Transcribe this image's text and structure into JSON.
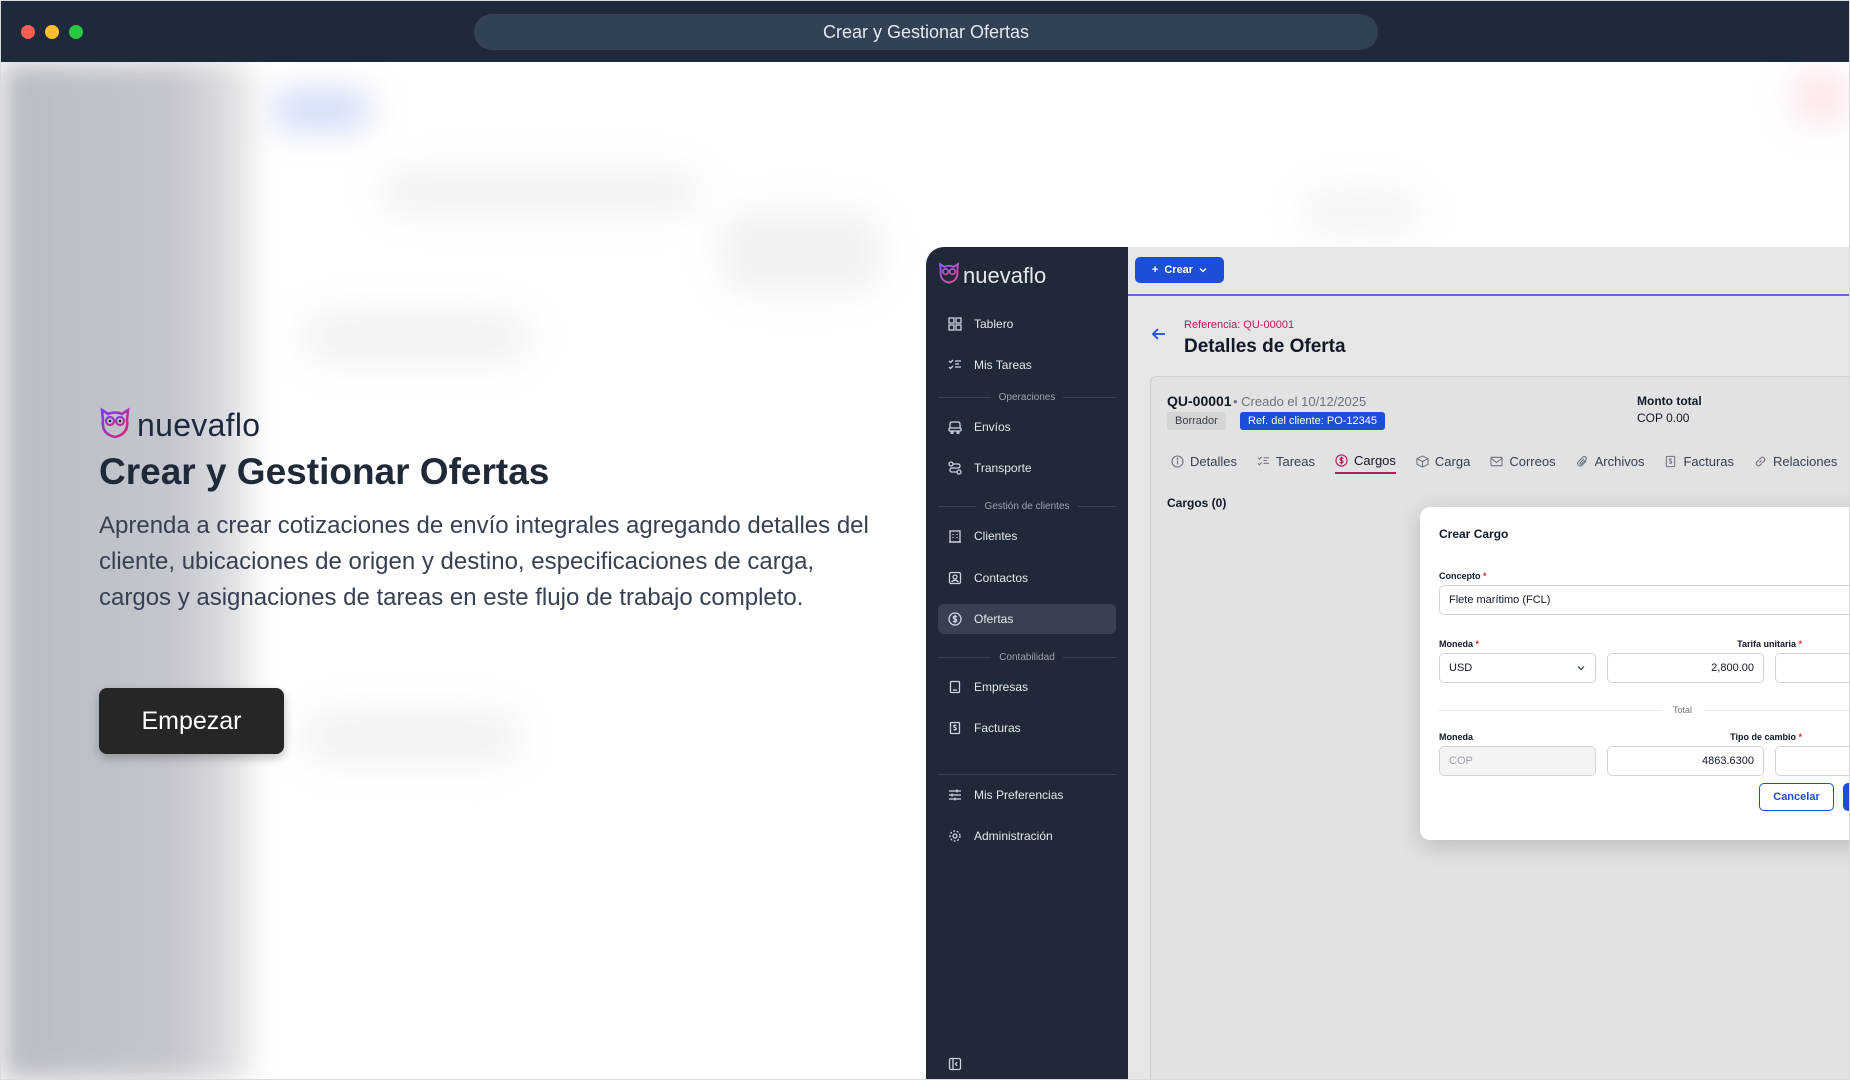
{
  "window": {
    "title": "Crear y Gestionar Ofertas"
  },
  "intro": {
    "brand": "nuevaflo",
    "title": "Crear y Gestionar Ofertas",
    "description": "Aprenda a crear cotizaciones de envío integrales agregando detalles del cliente, ubicaciones de origen y destino, especificaciones de carga, cargos y asignaciones de tareas en este flujo de trabajo completo.",
    "start_label": "Empezar"
  },
  "app": {
    "brand": "nuevaflo",
    "sidebar": {
      "items": [
        {
          "label": "Tablero",
          "icon": "dashboard-icon"
        },
        {
          "label": "Mis Tareas",
          "icon": "tasks-icon"
        },
        {
          "label": "Envíos",
          "icon": "shipments-icon"
        },
        {
          "label": "Transporte",
          "icon": "route-icon"
        },
        {
          "label": "Clientes",
          "icon": "building-icon"
        },
        {
          "label": "Contactos",
          "icon": "contact-icon"
        },
        {
          "label": "Ofertas",
          "icon": "dollar-circle-icon",
          "active": true
        },
        {
          "label": "Empresas",
          "icon": "company-icon"
        },
        {
          "label": "Facturas",
          "icon": "invoice-icon"
        },
        {
          "label": "Mis Preferencias",
          "icon": "sliders-icon"
        },
        {
          "label": "Administración",
          "icon": "settings-icon"
        }
      ],
      "sections": [
        "Operaciones",
        "Gestión de clientes",
        "Contabilidad"
      ]
    },
    "topbar": {
      "create_label": "Crear"
    },
    "header": {
      "reference": "Referencia: QU-00001",
      "title": "Detalles de Oferta"
    },
    "quote": {
      "id": "QU-00001",
      "created": "Creado el 10/12/2025",
      "status": "Borrador",
      "client_ref": "Ref. del cliente: PO-12345",
      "total_label": "Monto total",
      "total_value": "COP 0.00"
    },
    "tabs": [
      {
        "label": "Detalles",
        "icon": "info-icon"
      },
      {
        "label": "Tareas",
        "icon": "tasks-icon"
      },
      {
        "label": "Cargos",
        "icon": "dollar-circle-icon",
        "active": true
      },
      {
        "label": "Carga",
        "icon": "box-icon"
      },
      {
        "label": "Correos",
        "icon": "mail-icon"
      },
      {
        "label": "Archivos",
        "icon": "paperclip-icon"
      },
      {
        "label": "Facturas",
        "icon": "invoice-icon"
      },
      {
        "label": "Relaciones",
        "icon": "link-icon"
      }
    ],
    "charges_heading": "Cargos (0)",
    "modal": {
      "title": "Crear Cargo",
      "concept_label": "Concepto",
      "concept_value": "Flete marítimo (FCL)",
      "currency_label": "Moneda",
      "currency_value": "USD",
      "unit_rate_label": "Tarifa unitaria",
      "unit_rate_value": "2,800.00",
      "total_label": "Total",
      "total_currency_label": "Moneda",
      "total_currency_value": "COP",
      "exchange_label": "Tipo de cambio",
      "exchange_value": "4863.6300",
      "cancel_label": "Cancelar",
      "required_mark": "*"
    }
  },
  "colors": {
    "sidebar": "#1f2937",
    "accent": "#1d4ed8",
    "brand_pink": "#be185d"
  }
}
